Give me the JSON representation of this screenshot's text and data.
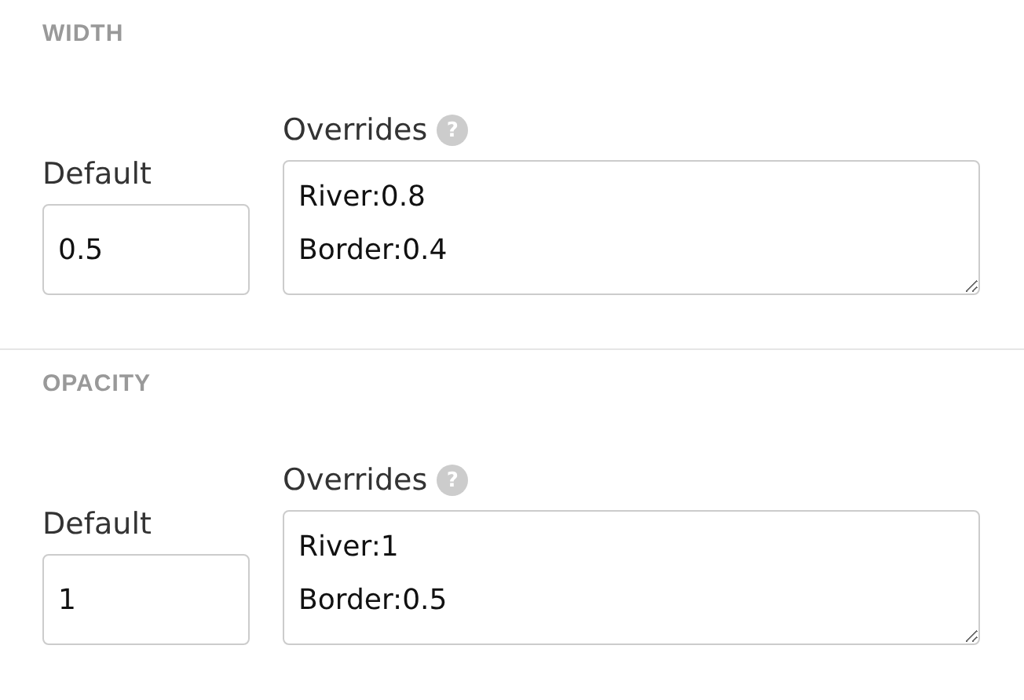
{
  "sections": [
    {
      "title": "WIDTH",
      "default_label": "Default",
      "default_value": "0.5",
      "overrides_label": "Overrides",
      "help": "?",
      "overrides_value": "River:0.8\nBorder:0.4"
    },
    {
      "title": "OPACITY",
      "default_label": "Default",
      "default_value": "1",
      "overrides_label": "Overrides",
      "help": "?",
      "overrides_value": "River:1\nBorder:0.5"
    }
  ]
}
